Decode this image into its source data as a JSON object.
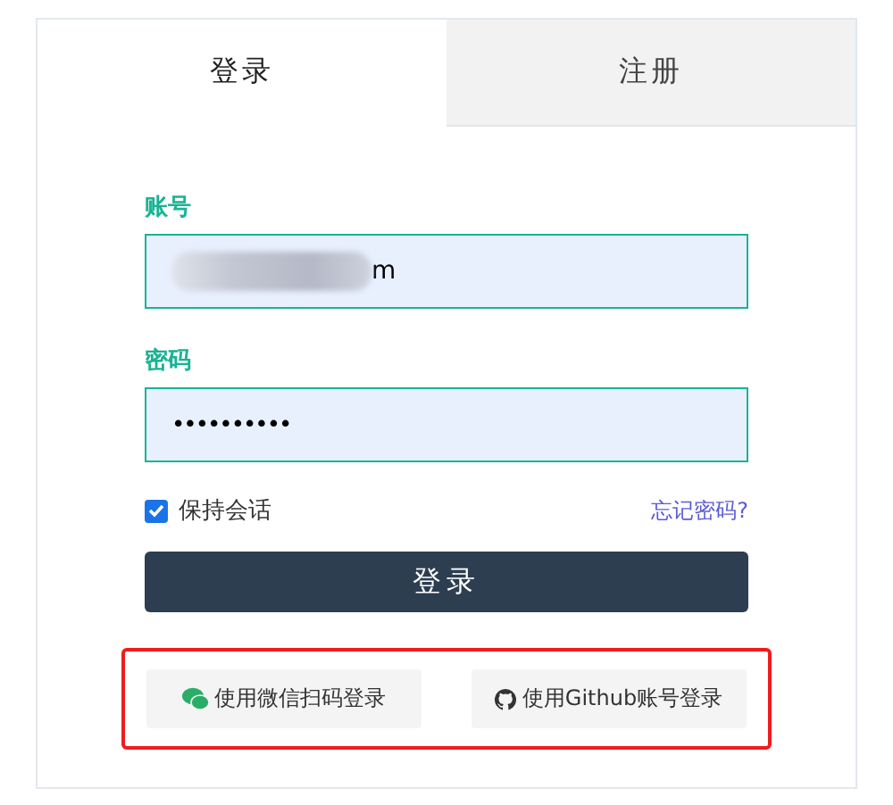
{
  "tabs": [
    {
      "label": "登录",
      "selected": true
    },
    {
      "label": "注册",
      "selected": false
    }
  ],
  "form": {
    "username": {
      "label": "账号",
      "value": "m",
      "redacted": true
    },
    "password": {
      "label": "密码",
      "value": "••••••••••"
    },
    "remember": {
      "label": "保持会话",
      "checked": true
    },
    "forgot_link": "忘记密码?",
    "submit": "登录"
  },
  "social_logins": {
    "highlighted": true,
    "buttons": [
      {
        "kind": "wechat",
        "label": "使用微信扫码登录"
      },
      {
        "kind": "github",
        "label": "使用Github账号登录"
      }
    ]
  }
}
